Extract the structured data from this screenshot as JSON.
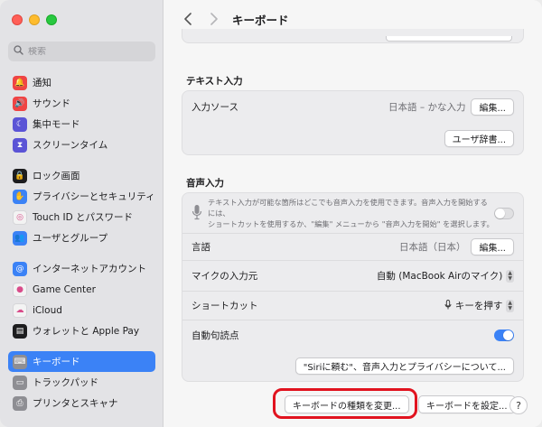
{
  "window": {
    "title": "キーボード"
  },
  "search": {
    "placeholder": "検索"
  },
  "sidebar": {
    "groups": [
      [
        {
          "label": "通知",
          "icon": "bell-icon",
          "color": "#ef4444"
        },
        {
          "label": "サウンド",
          "icon": "speaker-icon",
          "color": "#ef4444"
        },
        {
          "label": "集中モード",
          "icon": "moon-icon",
          "color": "#5b54d6"
        },
        {
          "label": "スクリーンタイム",
          "icon": "hourglass-icon",
          "color": "#5b54d6"
        }
      ],
      [
        {
          "label": "ロック画面",
          "icon": "lock-icon",
          "color": "#1d1d1f"
        },
        {
          "label": "プライバシーとセキュリティ",
          "icon": "hand-icon",
          "color": "#3b82f6"
        },
        {
          "label": "Touch ID とパスワード",
          "icon": "fingerprint-icon",
          "color": "#f3f3f3"
        },
        {
          "label": "ユーザとグループ",
          "icon": "users-icon",
          "color": "#3b82f6"
        }
      ],
      [
        {
          "label": "インターネットアカウント",
          "icon": "at-icon",
          "color": "#3b82f6"
        },
        {
          "label": "Game Center",
          "icon": "game-center-icon",
          "color": "#f3f3f3"
        },
        {
          "label": "iCloud",
          "icon": "cloud-icon",
          "color": "#f3f3f3"
        },
        {
          "label": "ウォレットと Apple Pay",
          "icon": "wallet-icon",
          "color": "#1d1d1f"
        }
      ],
      [
        {
          "label": "キーボード",
          "icon": "keyboard-icon",
          "color": "#8e8e93",
          "active": true
        },
        {
          "label": "トラックパッド",
          "icon": "trackpad-icon",
          "color": "#8e8e93"
        },
        {
          "label": "プリンタとスキャナ",
          "icon": "printer-icon",
          "color": "#8e8e93"
        }
      ]
    ]
  },
  "text_input": {
    "title": "テキスト入力",
    "source_label": "入力ソース",
    "source_value": "日本語 – かな入力",
    "edit_label": "編集...",
    "user_dict_label": "ユーザ辞書..."
  },
  "voice_input": {
    "title": "音声入力",
    "description_line1": "テキスト入力が可能な箇所はどこでも音声入力を使用できます。音声入力を開始するには、",
    "description_line2": "ショートカットを使用するか、\"編集\" メニューから \"音声入力を開始\" を選択します。",
    "dictation_enabled": false,
    "language_label": "言語",
    "language_value": "日本語（日本）",
    "edit_label": "編集...",
    "mic_label": "マイクの入力元",
    "mic_value": "自動 (MacBook Airのマイク)",
    "shortcut_label": "ショートカット",
    "shortcut_value": "キーを押す",
    "auto_punct_label": "自動句読点",
    "auto_punct_enabled": true,
    "siri_privacy_label": "\"Siriに頼む\"、音声入力とプライバシーについて..."
  },
  "footer": {
    "change_type_label": "キーボードの種類を変更...",
    "setup_label": "キーボードを設定...",
    "help_label": "?"
  },
  "colors": {
    "accent": "#3b82f6",
    "highlight": "#e1131f"
  }
}
